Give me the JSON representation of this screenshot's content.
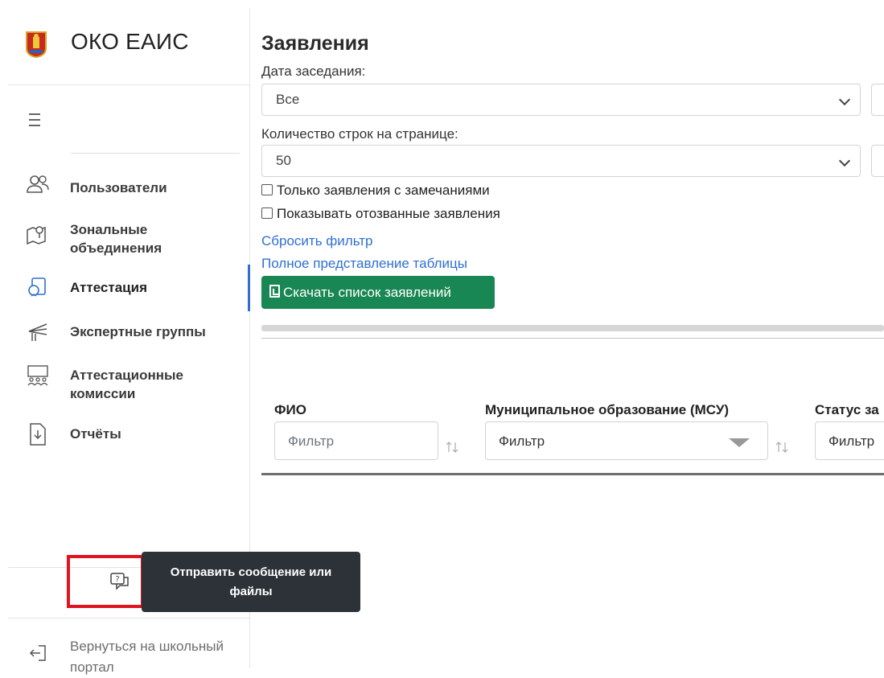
{
  "app": {
    "title": "ОКО ЕАИС"
  },
  "sidebar": {
    "items": [
      {
        "label": "Пользователи",
        "icon": "users-icon"
      },
      {
        "label": "Зональные объединения",
        "icon": "map-pin-icon"
      },
      {
        "label": "Аттестация",
        "icon": "attestation-icon",
        "active": true
      },
      {
        "label": "Экспертные группы",
        "icon": "expert-groups-icon"
      },
      {
        "label": "Аттестационные комиссии",
        "icon": "commission-icon"
      },
      {
        "label": "Отчёты",
        "icon": "report-download-icon"
      }
    ],
    "message_tooltip": "Отправить сообщение или файлы",
    "back_label": "Вернуться на школьный портал"
  },
  "main": {
    "title": "Заявления",
    "meeting_date_label": "Дата заседания:",
    "meeting_date_value": "Все",
    "rows_label": "Количество строк на странице:",
    "rows_value": "50",
    "checkbox_remarks": "Только заявления с замечаниями",
    "checkbox_revoked": "Показывать отозванные заявления",
    "reset_filter": "Сбросить фильтр",
    "full_view": "Полное представление таблицы",
    "download_button": "Скачать список заявлений",
    "table": {
      "columns": [
        {
          "header": "ФИО",
          "filter_placeholder": "Фильтр"
        },
        {
          "header": "Муниципальное образование (МСУ)",
          "filter_placeholder": "Фильтр"
        },
        {
          "header": "Статус за",
          "filter_placeholder": "Фильтр"
        }
      ]
    }
  },
  "colors": {
    "accent": "#2f6fd1",
    "download": "#198754",
    "highlight": "#e0141e",
    "tooltip_bg": "#2d3239"
  }
}
